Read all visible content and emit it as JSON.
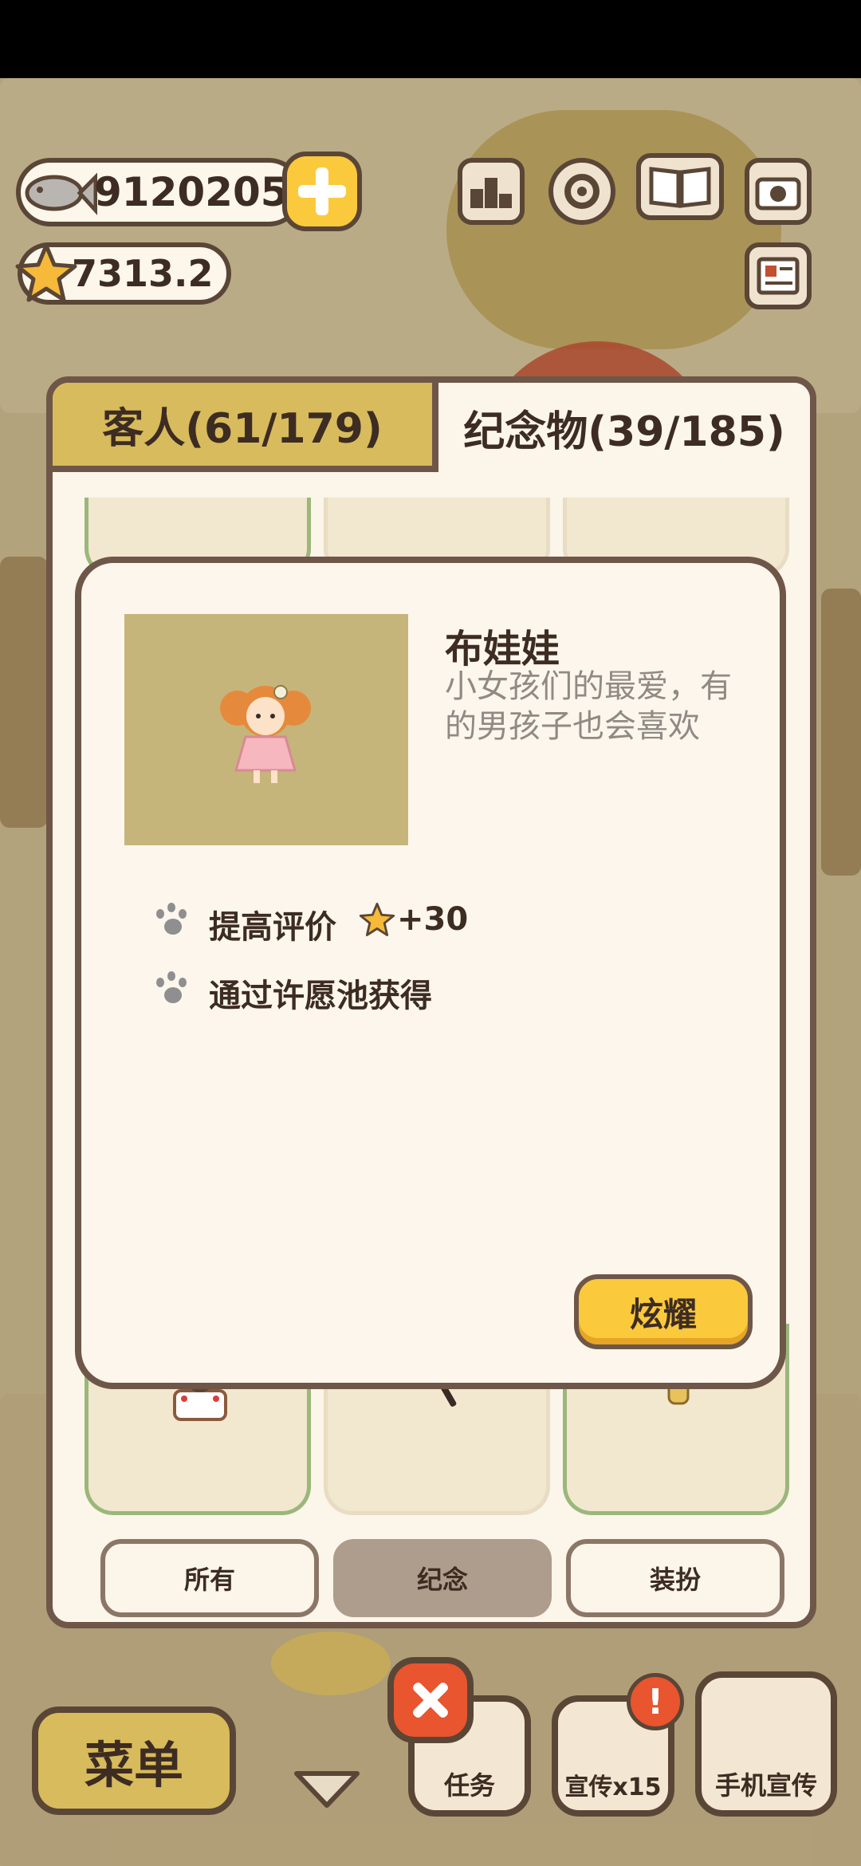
{
  "hud": {
    "fish_count": "9120205",
    "star_rating": "7313.2"
  },
  "panel": {
    "tabs": [
      {
        "label": "客人(61/179)"
      },
      {
        "label": "纪念物(39/185)"
      }
    ],
    "filters": [
      {
        "label": "所有"
      },
      {
        "label": "纪念"
      },
      {
        "label": "装扮"
      }
    ]
  },
  "detail": {
    "name": "布娃娃",
    "description": "小女孩们的最爱，有的男孩子也会喜欢",
    "effect_label": "提高评价",
    "effect_value": "+30",
    "source": "通过许愿池获得",
    "show_button": "炫耀"
  },
  "bottom_bar": {
    "menu": "菜单",
    "task": "任务",
    "promote": "宣传x15",
    "phone_promote": "手机宣传"
  },
  "colors": {
    "accent_yellow": "#fbc93c",
    "border_brown": "#6e5748",
    "card_bg": "#fdf6ec",
    "close_red": "#e8552e"
  }
}
